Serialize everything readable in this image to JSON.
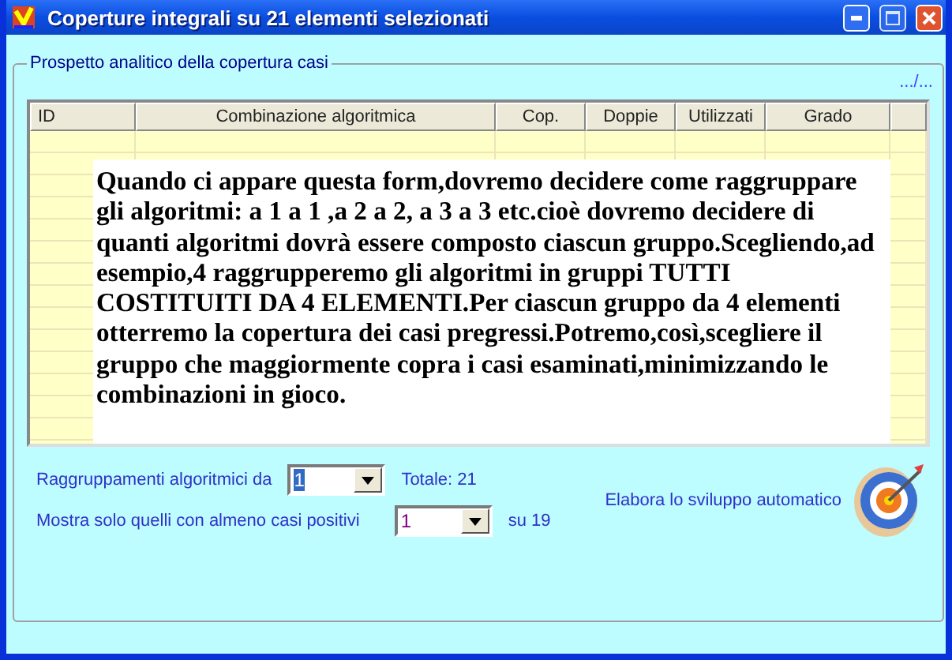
{
  "window": {
    "title": "Coperture integrali su 21 elementi selezionati"
  },
  "group": {
    "title": "Prospetto analitico della copertura casi",
    "pager": ".../..."
  },
  "table": {
    "columns": [
      "ID",
      "Combinazione algoritmica",
      "Cop.",
      "Doppie",
      "Utilizzati",
      "Grado"
    ]
  },
  "note": {
    "text": "Quando ci appare questa form,dovremo decidere come raggruppare gli algoritmi: a 1 a 1 ,a 2 a 2, a 3 a 3 etc.cioè dovremo decidere di quanti algoritmi dovrà essere composto ciascun gruppo.Scegliendo,ad esempio,4 raggrupperemo gli algoritmi in gruppi TUTTI COSTITUITI DA 4 ELEMENTI.Per ciascun gruppo da 4 elementi otterremo la copertura dei casi pregressi.Potremo,così,scegliere il gruppo che maggiormente copra i casi esaminati,minimizzando le combinazioni in gioco."
  },
  "grouping": {
    "label": "Raggruppamenti algoritmici da",
    "value": "1",
    "total": "Totale: 21"
  },
  "filter": {
    "label": "Mostra solo quelli con almeno casi positivi",
    "value": "1",
    "suffix": "su 19"
  },
  "action": {
    "label": "Elabora lo sviluppo automatico"
  }
}
